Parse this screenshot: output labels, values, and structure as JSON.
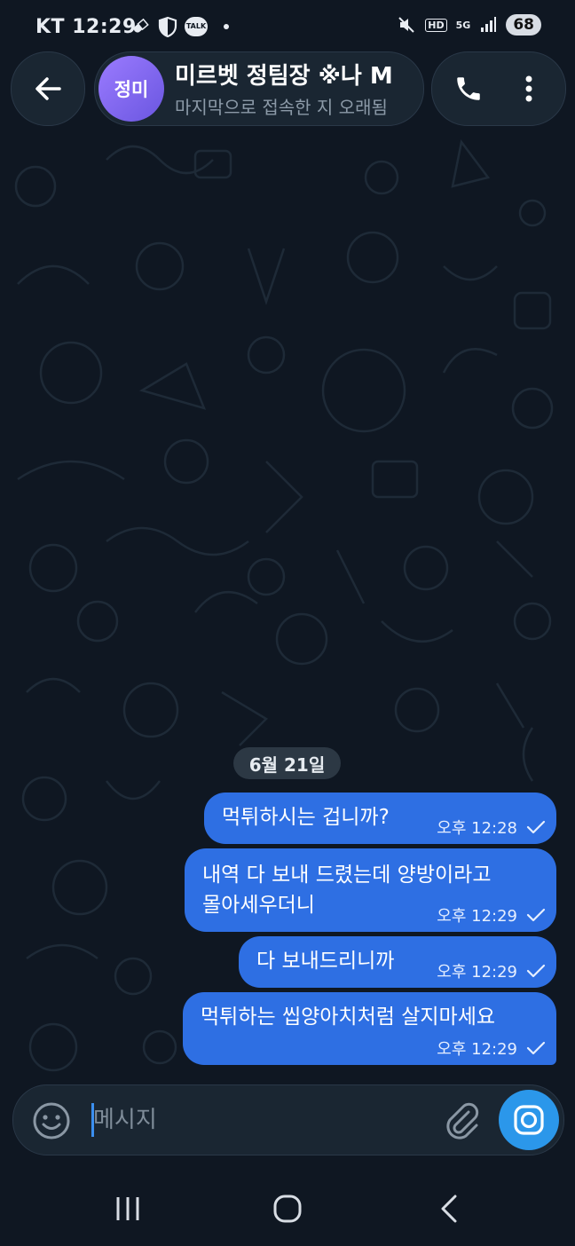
{
  "status_bar": {
    "carrier": "KT",
    "time": "12:29",
    "battery": "68",
    "icons": [
      "pill-icon",
      "shield-icon",
      "talk-icon",
      "dot-icon",
      "mute-icon",
      "hd-icon",
      "5g-icon",
      "signal-icon",
      "battery-icon"
    ],
    "talk_label": "TALK",
    "hd_label": "HD",
    "fiveg_label": "5G"
  },
  "header": {
    "avatar_initials": "정미",
    "chat_name": "미르벳 정팀장 ※나 M",
    "chat_status": "마지막으로 접속한 지 오래됨",
    "avatar_color": "#8a6cf0"
  },
  "date_chip": "6월 21일",
  "messages": [
    {
      "lines": [
        "먹튀하시는 겁니까?"
      ],
      "time": "오후 12:28",
      "read": true
    },
    {
      "lines": [
        "내역 다 보내 드렸는데 양방이라고",
        "몰아세우더니"
      ],
      "time": "오후 12:29",
      "read": true
    },
    {
      "lines": [
        "다 보내드리니까"
      ],
      "time": "오후 12:29",
      "read": true
    },
    {
      "lines": [
        "먹튀하는 씹양아치처럼 살지마세요"
      ],
      "time": "오후 12:29",
      "read": true
    }
  ],
  "composer": {
    "placeholder": "메시지",
    "value": ""
  },
  "theme": {
    "bubble_color": "#2e6fe3",
    "background": "#0f1722",
    "accent": "#2b97ea"
  },
  "navbar": {
    "icons": [
      "recent-apps-icon",
      "home-icon",
      "back-nav-icon"
    ]
  }
}
